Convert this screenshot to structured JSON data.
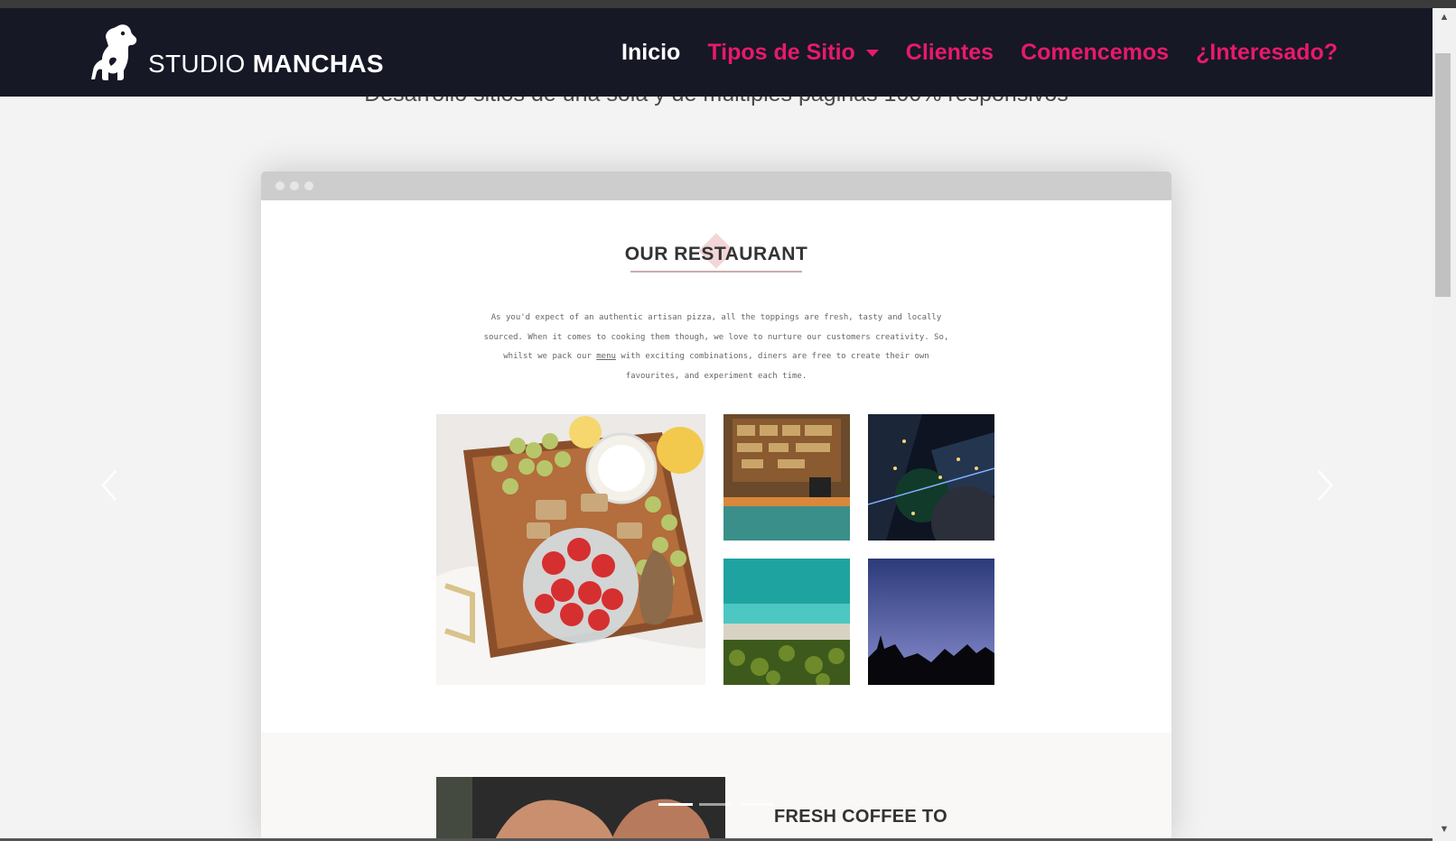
{
  "brand": {
    "name_light": "STUDIO",
    "name_bold": "MANCHAS",
    "logo_icon": "dog-logo-icon"
  },
  "nav": {
    "items": [
      {
        "label": "Inicio",
        "active": true
      },
      {
        "label": "Tipos de Sitio",
        "dropdown": true
      },
      {
        "label": "Clientes"
      },
      {
        "label": "Comencemos"
      },
      {
        "label": "¿Interesado?"
      }
    ]
  },
  "hero": {
    "subtitle": "Desarrollo sitios de una sola y de múltiples páginas 100% responsivos"
  },
  "carousel": {
    "slide": {
      "heading": "OUR RESTAURANT",
      "paragraph_1": "As you'd expect of an authentic artisan pizza, all the toppings are fresh, tasty and locally sourced. When it comes to cooking them though, we love to nurture our customers creativity. So, whilst we pack our",
      "link_text": "menu",
      "paragraph_2": "with exciting combinations, diners are free to create their own favourites, and experiment each time.",
      "section2_heading": "FRESH COFFEE TO"
    },
    "indicators": [
      true,
      false,
      false
    ]
  },
  "colors": {
    "navbar_bg": "#161826",
    "accent": "#e8196e",
    "active_link": "#ffffff"
  }
}
